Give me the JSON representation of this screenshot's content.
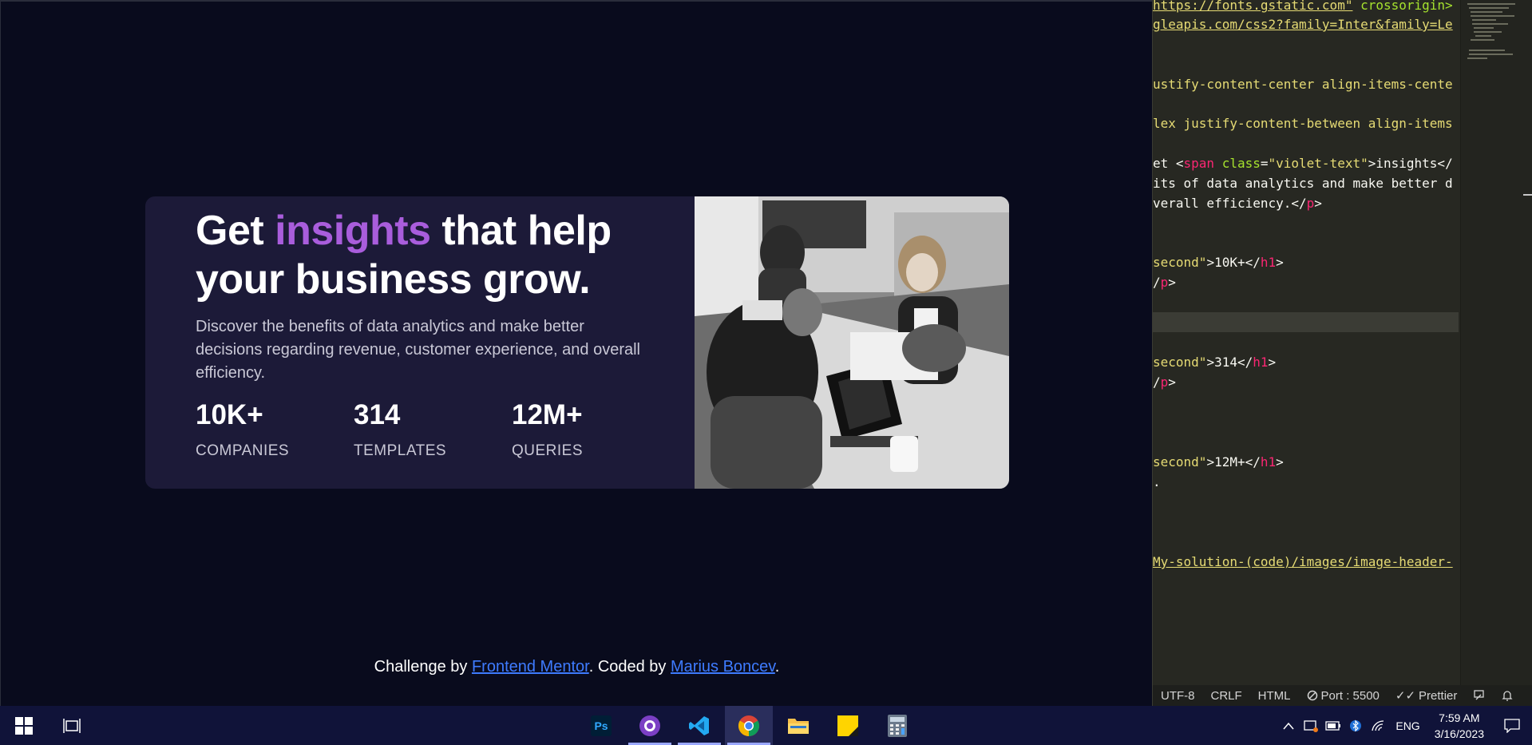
{
  "hero": {
    "title_prefix": "Get ",
    "title_highlight": "insights",
    "title_suffix": " that help your business grow.",
    "description": "Discover the benefits of data analytics and make better decisions regarding revenue, customer experience, and overall efficiency."
  },
  "stats": [
    {
      "value": "10K+",
      "label": "COMPANIES"
    },
    {
      "value": "314",
      "label": "TEMPLATES"
    },
    {
      "value": "12M+",
      "label": "QUERIES"
    }
  ],
  "footer": {
    "prefix": "Challenge by ",
    "link1": "Frontend Mentor",
    "middle": ". Coded by ",
    "link2": "Marius Boncev",
    "suffix": "."
  },
  "editor": {
    "line1_str": "https://fonts.gstatic.com\"",
    "line1_attr": " crossorigin>",
    "line2": "gleapis.com/css2?family=Inter&family=Le",
    "line3": "ustify-content-center align-items-cente",
    "line4": "lex justify-content-between align-items",
    "line5_a": "et <",
    "line5_tag": "span",
    "line5_attr": " class",
    "line5_eq": "=",
    "line5_str": "\"violet-text\"",
    "line5_b": ">insights</",
    "line6": "its of data analytics and make better d",
    "line7_a": "verall efficiency.</",
    "line7_tag": "p",
    "line7_b": ">",
    "line8_str": "second\"",
    "line8_a": ">10K+</",
    "line8_tag": "h1",
    "line8_b": ">",
    "line9_tag": "p",
    "line9_b": ">",
    "line9_a": "/",
    "line10_str": "second\"",
    "line10_a": ">314</",
    "line10_tag": "h1",
    "line10_b": ">",
    "line11_a": "/",
    "line11_tag": "p",
    "line11_b": ">",
    "line12_str": "second\"",
    "line12_a": ">12M+</",
    "line12_tag": "h1",
    "line12_b": ">",
    "line13": ".",
    "line14": "My-solution-(code)/images/image-header-"
  },
  "statusbar": {
    "encoding": "UTF-8",
    "eol": "CRLF",
    "language": "HTML",
    "port": "Port : 5500",
    "prettier": "Prettier"
  },
  "taskbar": {
    "lang": "ENG",
    "time": "7:59 AM",
    "date": "3/16/2023",
    "ps_label": "Ps"
  },
  "colors": {
    "page_bg": "#090b1d",
    "card_bg": "#1c1a38",
    "accent_violet": "#a95ddc",
    "link_blue": "#3e7bff",
    "taskbar_bg": "#101339"
  }
}
